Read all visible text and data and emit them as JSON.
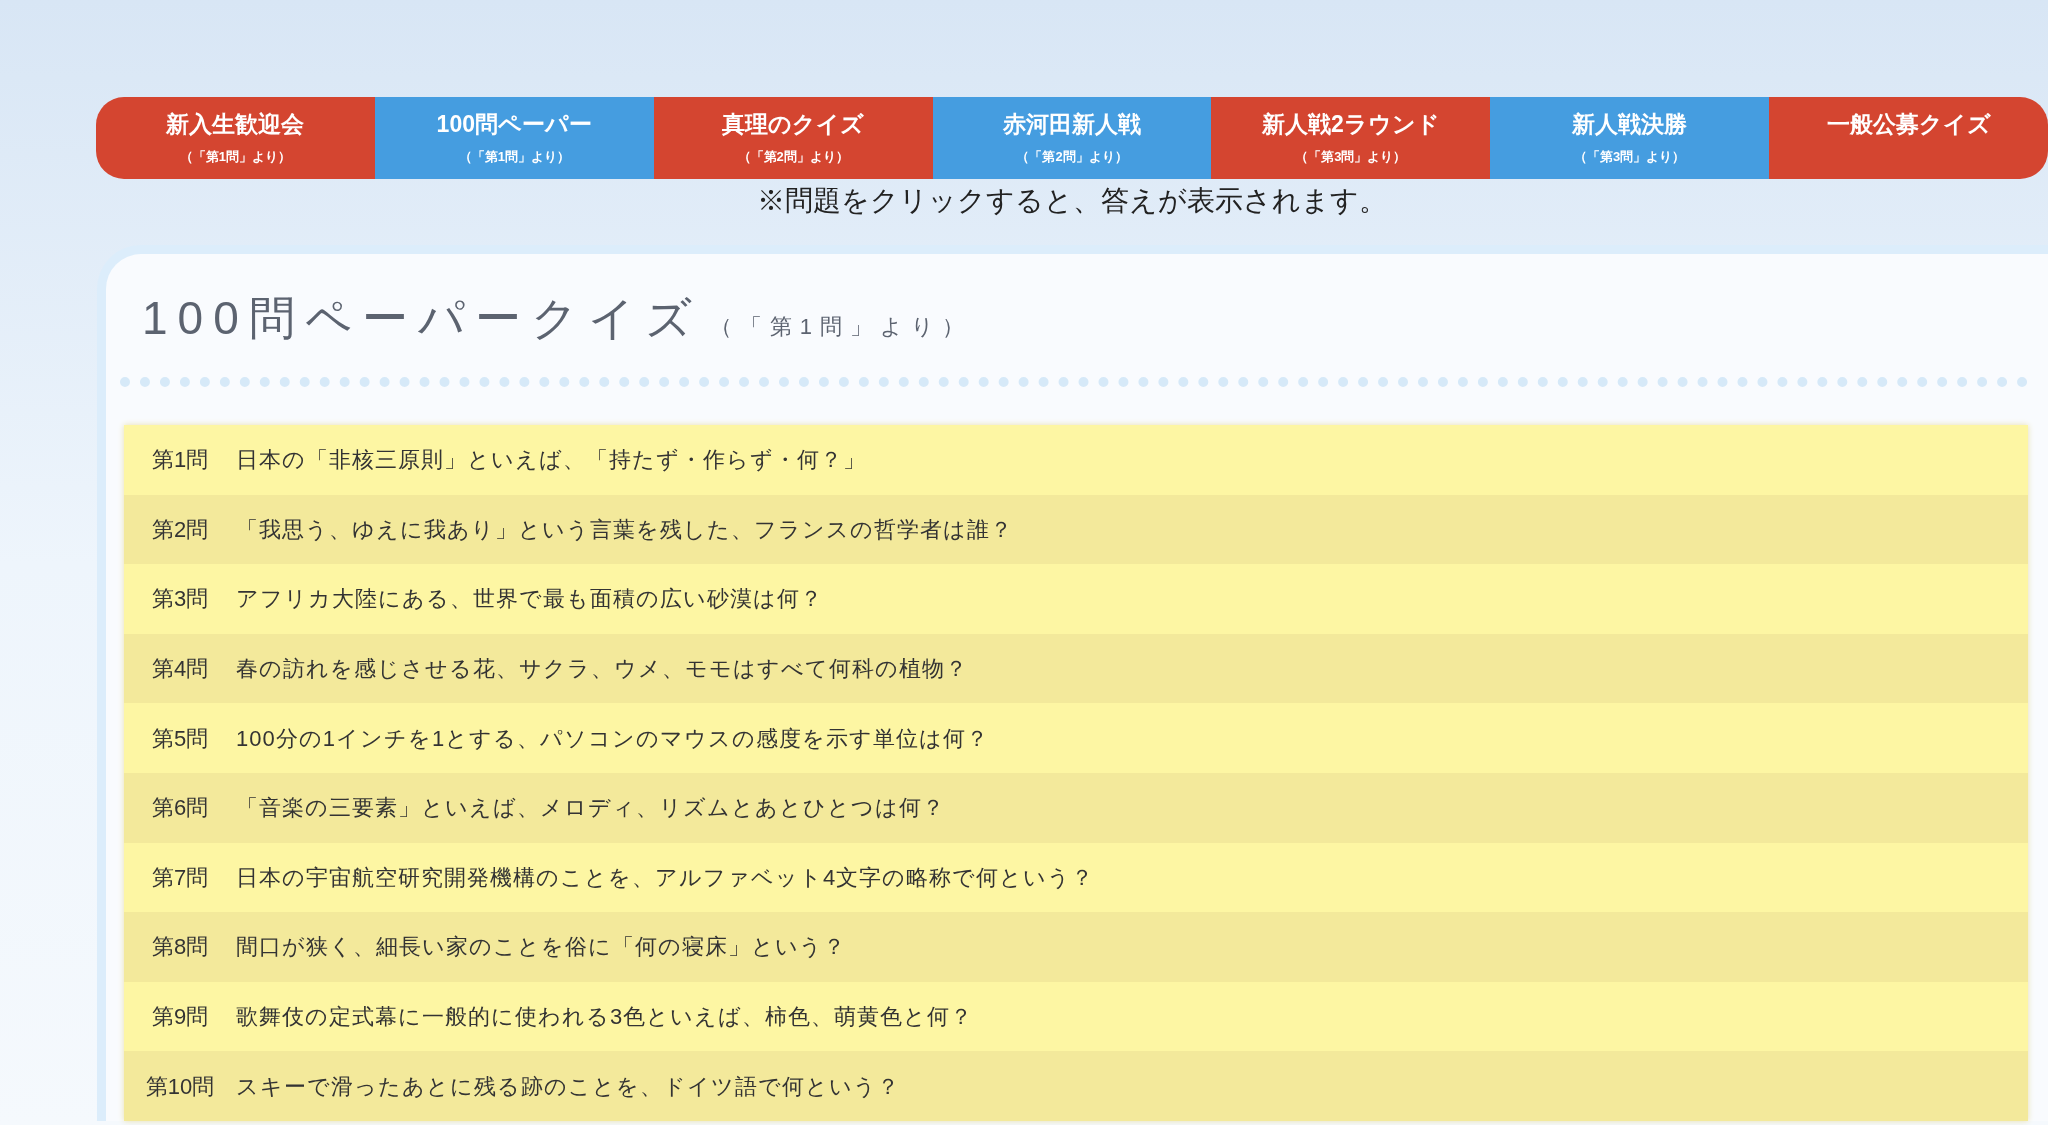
{
  "tabs": [
    {
      "label": "新入生歓迎会",
      "sub": "（「第1問」より）",
      "color": "#d44530"
    },
    {
      "label": "100問ペーパー",
      "sub": "（「第1問」より）",
      "color": "#459de0"
    },
    {
      "label": "真理のクイズ",
      "sub": "（「第2問」より）",
      "color": "#d44530"
    },
    {
      "label": "赤河田新人戦",
      "sub": "（「第2問」より）",
      "color": "#459de0"
    },
    {
      "label": "新人戦2ラウンド",
      "sub": "（「第3問」より）",
      "color": "#d44530"
    },
    {
      "label": "新人戦決勝",
      "sub": "（「第3問」より）",
      "color": "#459de0"
    },
    {
      "label": "一般公募クイズ",
      "color": "#d44530"
    }
  ],
  "notice": "※問題をクリックすると、答えが表示されます。",
  "section": {
    "title": "100問ペーパークイズ",
    "subtitle": "（「第1問」より）"
  },
  "questions": [
    {
      "number": "第1問",
      "text": "日本の「非核三原則」といえば、「持たず・作らず・何？」"
    },
    {
      "number": "第2問",
      "text": "「我思う、ゆえに我あり」という言葉を残した、フランスの哲学者は誰？"
    },
    {
      "number": "第3問",
      "text": "アフリカ大陸にある、世界で最も面積の広い砂漠は何？"
    },
    {
      "number": "第4問",
      "text": "春の訪れを感じさせる花、サクラ、ウメ、モモはすべて何科の植物？"
    },
    {
      "number": "第5問",
      "text": "100分の1インチを1とする、パソコンのマウスの感度を示す単位は何？"
    },
    {
      "number": "第6問",
      "text": "「音楽の三要素」といえば、メロディ、リズムとあとひとつは何？"
    },
    {
      "number": "第7問",
      "text": "日本の宇宙航空研究開発機構のことを、アルファベット4文字の略称で何という？"
    },
    {
      "number": "第8問",
      "text": "間口が狭く、細長い家のことを俗に「何の寝床」という？"
    },
    {
      "number": "第9問",
      "text": "歌舞伎の定式幕に一般的に使われる3色といえば、柿色、萌黄色と何？"
    },
    {
      "number": "第10問",
      "text": "スキーで滑ったあとに残る跡のことを、ドイツ語で何という？"
    }
  ]
}
